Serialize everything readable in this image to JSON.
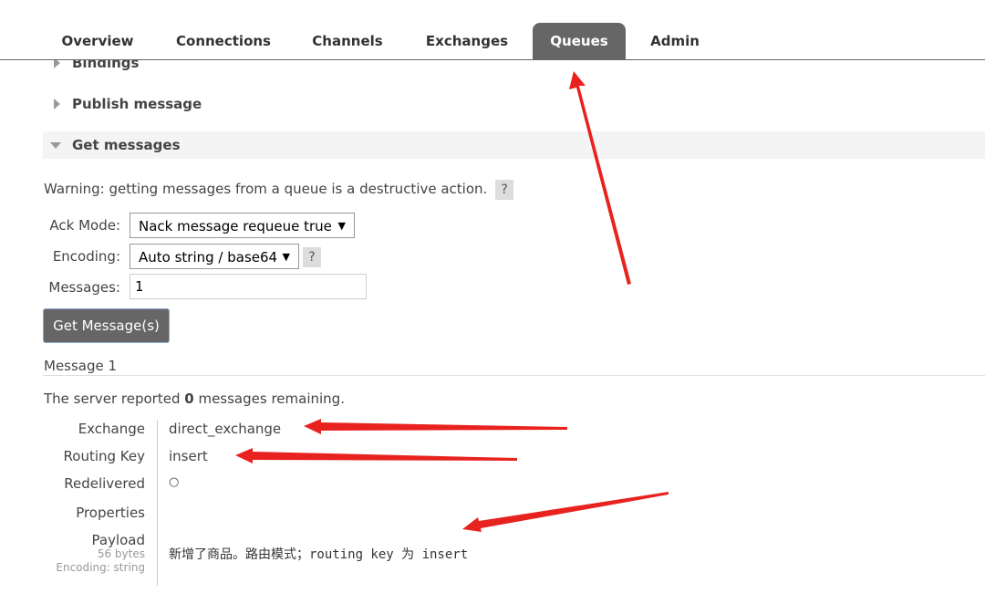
{
  "tabs": [
    {
      "label": "Overview"
    },
    {
      "label": "Connections"
    },
    {
      "label": "Channels"
    },
    {
      "label": "Exchanges"
    },
    {
      "label": "Queues",
      "active": true
    },
    {
      "label": "Admin"
    }
  ],
  "sections": {
    "bindings": "Bindings",
    "publish": "Publish message",
    "get": "Get messages"
  },
  "get_messages": {
    "warning": "Warning: getting messages from a queue is a destructive action.",
    "help": "?",
    "ack_mode_label": "Ack Mode:",
    "ack_mode_value": "Nack message requeue true",
    "encoding_label": "Encoding:",
    "encoding_value": "Auto string / base64",
    "messages_label": "Messages:",
    "messages_value": "1",
    "button": "Get Message(s)"
  },
  "message": {
    "title": "Message 1",
    "remaining_prefix": "The server reported ",
    "remaining_count": "0",
    "remaining_suffix": " messages remaining.",
    "exchange_label": "Exchange",
    "exchange_value": "direct_exchange",
    "routing_key_label": "Routing Key",
    "routing_key_value": "insert",
    "redelivered_label": "Redelivered",
    "redelivered_value": "○",
    "properties_label": "Properties",
    "payload_label": "Payload",
    "payload_bytes": "56 bytes",
    "payload_encoding": "Encoding: string",
    "payload_value": "新增了商品。路由模式；routing key 为 insert"
  },
  "colors": {
    "tab_active_bg": "#666666",
    "annotation_arrow": "#e8231f"
  }
}
